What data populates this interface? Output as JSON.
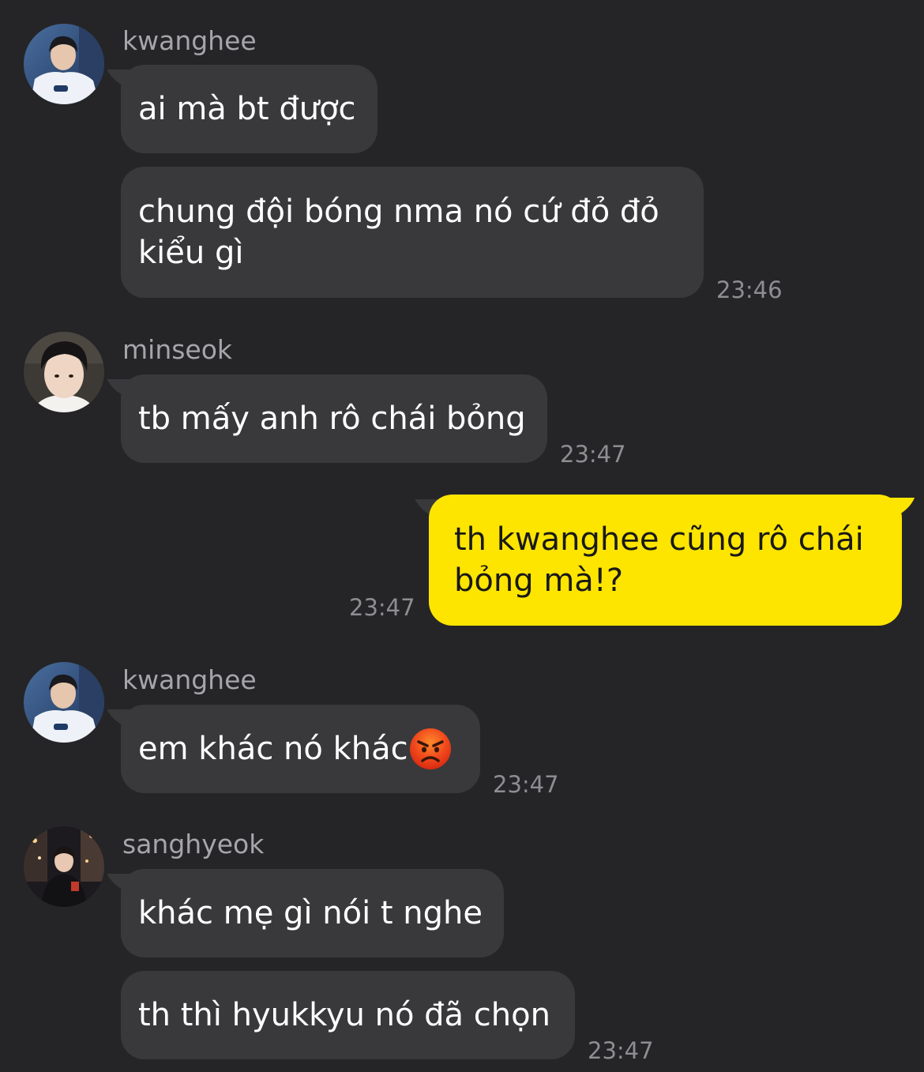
{
  "messages": {
    "m1": {
      "sender": "kwanghee",
      "text": "ai mà bt được"
    },
    "m2": {
      "text": "chung đội bóng nma nó cứ đỏ đỏ\nkiểu gì",
      "time": "23:46"
    },
    "m3": {
      "sender": "minseok",
      "text": "tb mấy anh rô chái bỏng",
      "time": "23:47"
    },
    "m4": {
      "text": "th kwanghee cũng rô chái\nbỏng mà!?",
      "time": "23:47"
    },
    "m5": {
      "sender": "kwanghee",
      "text": "em khác nó khác",
      "emoji": "angry-face-icon",
      "time": "23:47"
    },
    "m6": {
      "sender": "sanghyeok",
      "text": "khác mẹ gì nói t nghe"
    },
    "m7": {
      "text": "th thì hyukkyu nó đã chọn",
      "time": "23:47"
    }
  },
  "colors": {
    "background": "#252527",
    "incoming_bubble": "#39393c",
    "outgoing_bubble": "#fee500",
    "name_text": "#a6a6aa",
    "time_text": "#8e8e92"
  }
}
